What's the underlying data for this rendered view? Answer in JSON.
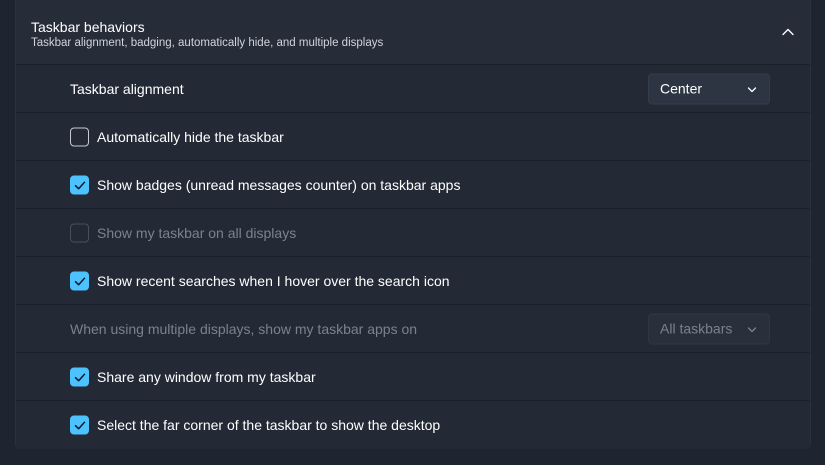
{
  "section": {
    "title": "Taskbar behaviors",
    "subtitle": "Taskbar alignment, badging, automatically hide, and multiple displays"
  },
  "alignment": {
    "label": "Taskbar alignment",
    "value": "Center"
  },
  "options": [
    {
      "label": "Automatically hide the taskbar",
      "checked": false,
      "enabled": true
    },
    {
      "label": "Show badges (unread messages counter) on taskbar apps",
      "checked": true,
      "enabled": true
    },
    {
      "label": "Show my taskbar on all displays",
      "checked": false,
      "enabled": false
    },
    {
      "label": "Show recent searches when I hover over the search icon",
      "checked": true,
      "enabled": true
    }
  ],
  "multi_display": {
    "label": "When using multiple displays, show my taskbar apps on",
    "value": "All taskbars",
    "enabled": false
  },
  "options2": [
    {
      "label": "Share any window from my taskbar",
      "checked": true,
      "enabled": true
    },
    {
      "label": "Select the far corner of the taskbar to show the desktop",
      "checked": true,
      "enabled": true
    }
  ],
  "colors": {
    "accent": "#4cc2ff",
    "background": "#1e2430",
    "card": "#232a36",
    "disabled_text": "#7c828c"
  }
}
